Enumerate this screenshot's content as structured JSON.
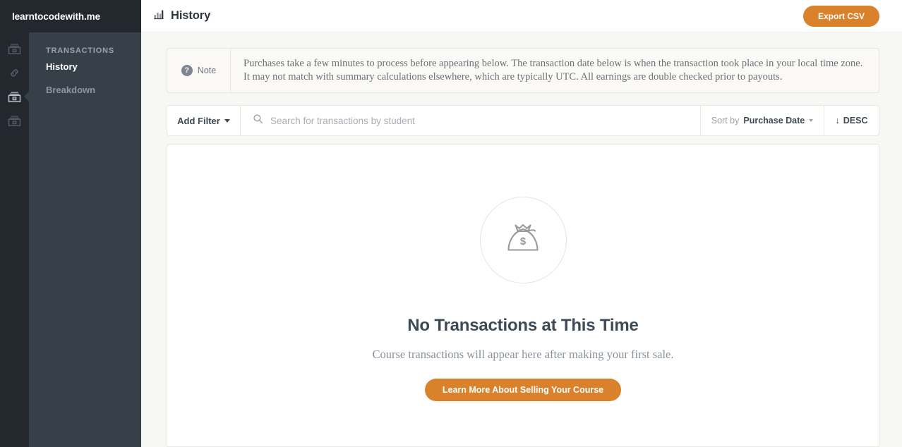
{
  "brand": {
    "name": "learntocodewith.me"
  },
  "rail": {
    "items": [
      {
        "icon": "money-bills-icon",
        "active": false
      },
      {
        "icon": "link-icon",
        "active": false
      },
      {
        "icon": "money-bills-icon",
        "active": true
      },
      {
        "icon": "money-bills-icon",
        "active": false
      }
    ]
  },
  "sidebar": {
    "section_title": "TRANSACTIONS",
    "items": [
      {
        "label": "History",
        "active": true
      },
      {
        "label": "Breakdown",
        "active": false
      }
    ]
  },
  "header": {
    "icon": "bar-chart-icon",
    "title": "History",
    "export_label": "Export CSV"
  },
  "note": {
    "icon": "question-circle-icon",
    "label": "Note",
    "text": "Purchases take a few minutes to process before appearing below. The transaction date below is when the transaction took place in your local time zone. It may not match with summary calculations elsewhere, which are typically UTC. All earnings are double checked prior to payouts."
  },
  "filters": {
    "add_filter_label": "Add Filter",
    "search_placeholder": "Search for transactions by student",
    "search_value": "",
    "sort_by_label": "Sort by",
    "sort_value": "Purchase Date",
    "sort_direction": "DESC",
    "sort_direction_arrow": "↓"
  },
  "empty_state": {
    "illustration": "money-bag-icon",
    "heading": "No Transactions at This Time",
    "subtitle": "Course transactions will appear here after making your first sale.",
    "cta_label": "Learn More About Selling Your Course"
  },
  "colors": {
    "accent_orange": "#d9822b",
    "rail_dark": "#23282f",
    "sidebar_dark": "#373f49",
    "page_bg": "#f7f7f3",
    "card_white": "#ffffff"
  }
}
